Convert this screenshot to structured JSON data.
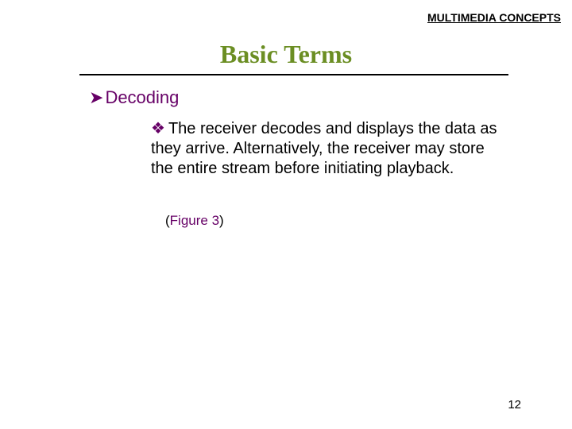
{
  "header": {
    "label": "MULTIMEDIA CONCEPTS"
  },
  "title": "Basic Terms",
  "content": {
    "level1": {
      "bullet": "➤",
      "text": "Decoding"
    },
    "level2": {
      "bullet": "❖",
      "text": "The receiver decodes and displays the data as they arrive. Alternatively, the receiver may store the entire stream before initiating playback."
    },
    "figref": {
      "open": "(",
      "label": "Figure 3",
      "close": ")"
    }
  },
  "page_number": "12"
}
